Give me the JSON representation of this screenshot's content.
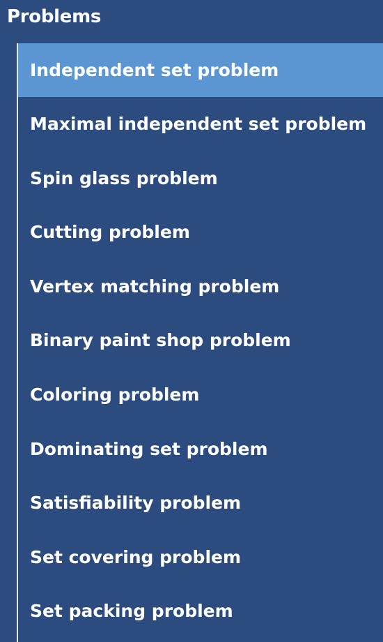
{
  "section": {
    "title": "Problems"
  },
  "nav": {
    "active_index": 0,
    "items": [
      {
        "label": "Independent set problem"
      },
      {
        "label": "Maximal independent set problem"
      },
      {
        "label": "Spin glass problem"
      },
      {
        "label": "Cutting problem"
      },
      {
        "label": "Vertex matching problem"
      },
      {
        "label": "Binary paint shop problem"
      },
      {
        "label": "Coloring problem"
      },
      {
        "label": "Dominating set problem"
      },
      {
        "label": "Satisfiability problem"
      },
      {
        "label": "Set covering problem"
      },
      {
        "label": "Set packing problem"
      }
    ]
  },
  "colors": {
    "background": "#2c4b7e",
    "active_item": "#5b96d3",
    "text": "#ffffff",
    "rail": "#dfe7f3"
  }
}
